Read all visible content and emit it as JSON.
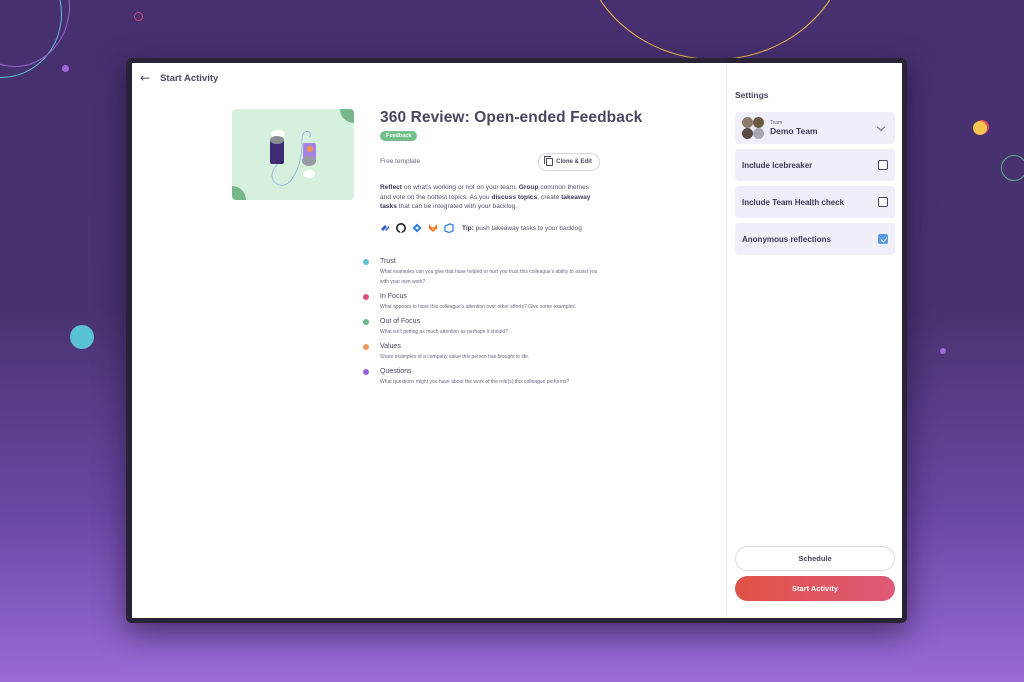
{
  "header": {
    "back_label": "Start Activity"
  },
  "template": {
    "title": "360 Review: Open-ended Feedback",
    "badge": "Feedback",
    "type_label": "Free template",
    "clone_label": "Clone & Edit",
    "description": {
      "reflect": "Reflect",
      "part1": " on what's working or not on your team. ",
      "group": "Group",
      "part2": " common themes and vote on the hottest topics. As you ",
      "discuss": "discuss topics",
      "part3": ", create ",
      "takeaway": "takeaway tasks",
      "part4": " that can be integrated with your backlog."
    },
    "integrations": [
      "jira-icon",
      "github-icon",
      "jira-software-icon",
      "gitlab-icon",
      "azure-devops-icon"
    ],
    "tip_label": "Tip:",
    "tip_text": " push takeaway tasks to your backlog"
  },
  "topics": [
    {
      "name": "Trust",
      "color": "#5bc0d2",
      "description": "What examples can you give that have helped or hurt you trust this colleague's ability to assist you with your own work?"
    },
    {
      "name": "In Focus",
      "color": "#e0507a",
      "description": "What appears to have this colleague's attention over other efforts? Give some examples."
    },
    {
      "name": "Out of Focus",
      "color": "#6cb987",
      "description": "What isn't getting as much attention as perhaps it should?"
    },
    {
      "name": "Values",
      "color": "#f09a5a",
      "description": "Share examples of a company value this person has brought to life."
    },
    {
      "name": "Questions",
      "color": "#9a62d8",
      "description": "What questions might you have about the work of the role(s) this colleague performs?"
    }
  ],
  "settings": {
    "title": "Settings",
    "team_label": "Team",
    "team_name": "Demo Team",
    "options": [
      {
        "label": "Include Icebreaker",
        "checked": false
      },
      {
        "label": "Include Team Health check",
        "checked": false
      },
      {
        "label": "Anonymous reflections",
        "checked": true
      }
    ],
    "schedule_label": "Schedule",
    "start_label": "Start Activity"
  }
}
